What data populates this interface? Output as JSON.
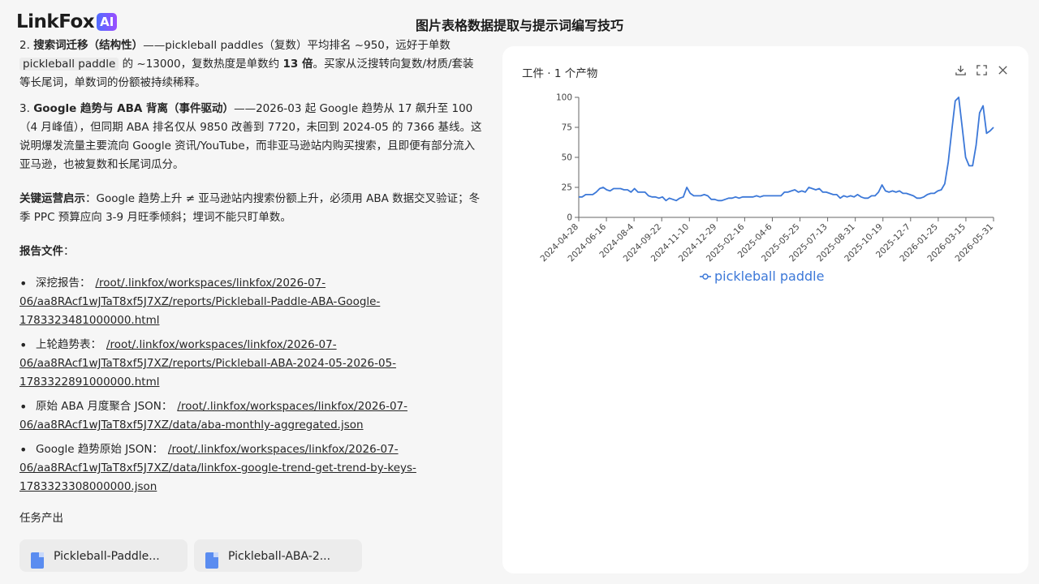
{
  "header": {
    "logo_text": "LinkFox",
    "logo_badge": "AI",
    "title": "图片表格数据提取与提示词编写技巧"
  },
  "content": {
    "para2": {
      "num": "2.",
      "heading": "搜索词迁移（结构性）",
      "text1": "——pickleball paddles（复数）平均排名 ~950，远好于单数",
      "code": "pickleball paddle",
      "text2": "的 ~13000，复数热度是单数约",
      "bold2": "13 倍",
      "text3": "。买家从泛搜转向复数/材质/套装等长尾词，单数词的份额被持续稀释。"
    },
    "para3": {
      "num": "3.",
      "heading": "Google 趋势与 ABA 背离（事件驱动）",
      "text": "——2026-03 起 Google 趋势从 17 飙升至 100（4 月峰值），但同期 ABA 排名仅从 9850 改善到 7720，未回到 2024-05 的 7366 基线。这说明爆发流量主要流向 Google 资讯/YouTube，而非亚马逊站内购买搜索，且即便有部分流入亚马逊，也被复数和长尾词瓜分。"
    },
    "insight": {
      "heading": "关键运营启示",
      "text": "：Google 趋势上升 ≠ 亚马逊站内搜索份额上升，必须用 ABA 数据交叉验证；冬季 PPC 预算应向 3-9 月旺季倾斜；埋词不能只盯单数。"
    },
    "files_label": "报告文件",
    "files_colon": "：",
    "files": [
      {
        "name": "深挖报告：",
        "path_a": "/root/.linkfox/workspaces/linkfox/2026-07-",
        "path_b": "06/aa8RAcf1wJTaT8xf5J7XZ/reports/Pickleball-Paddle-ABA-Google-",
        "path_c": "1783323481000000.html"
      },
      {
        "name": "上轮趋势表：",
        "path_a": "/root/.linkfox/workspaces/linkfox/2026-07-",
        "path_b": "06/aa8RAcf1wJTaT8xf5J7XZ/reports/Pickleball-ABA-2024-05-2026-05-",
        "path_c": "1783322891000000.html"
      },
      {
        "name": "原始 ABA 月度聚合 JSON：",
        "path_a": "/root/.linkfox/workspaces/linkfox/2026-07-",
        "path_b": "06/aa8RAcf1wJTaT8xf5J7XZ/data/aba-monthly-aggregated.json",
        "path_c": ""
      },
      {
        "name": "Google 趋势原始 JSON：",
        "path_a": "/root/.linkfox/workspaces/linkfox/2026-07-",
        "path_b": "06/aa8RAcf1wJTaT8xf5J7XZ/data/linkfox-google-trend-get-trend-by-keys-",
        "path_c": "1783323308000000.json"
      }
    ],
    "output_label": "任务产出",
    "output_cards": [
      {
        "label": "Pickleball-Paddle..."
      },
      {
        "label": "Pickleball-ABA-2..."
      }
    ]
  },
  "panel": {
    "title": "工件 · 1 个产物",
    "tools": {
      "download": "download-icon",
      "fullscreen": "fullscreen-icon",
      "close": "close-icon"
    }
  },
  "chart_data": {
    "type": "line",
    "title": "",
    "xlabel": "",
    "ylabel": "",
    "ylim": [
      0,
      100
    ],
    "yticks": [
      0,
      25,
      50,
      75,
      100
    ],
    "xticks": [
      "2024-04-28",
      "2024-06-16",
      "2024-08-4",
      "2024-09-22",
      "2024-11-10",
      "2024-12-29",
      "2025-02-16",
      "2025-04-6",
      "2025-05-25",
      "2025-07-13",
      "2025-08-31",
      "2025-10-19",
      "2025-12-7",
      "2026-01-25",
      "2026-03-15",
      "2026-05-31"
    ],
    "legend_position": "bottom-center",
    "series": [
      {
        "name": "pickleball paddle",
        "color": "#3c78d8",
        "values": [
          17,
          17,
          19,
          19,
          19,
          21,
          24,
          25,
          23,
          22,
          24,
          24,
          24,
          23,
          23,
          21,
          24,
          21,
          21,
          21,
          18,
          17,
          17,
          16,
          17,
          14,
          16,
          15,
          14,
          16,
          17,
          25,
          20,
          18,
          18,
          18,
          19,
          18,
          15,
          15,
          14,
          14,
          15,
          16,
          16,
          17,
          16,
          17,
          17,
          17,
          17,
          18,
          17,
          18,
          18,
          18,
          18,
          18,
          18,
          21,
          21,
          22,
          23,
          21,
          22,
          21,
          25,
          24,
          23,
          24,
          21,
          21,
          20,
          19,
          19,
          16,
          18,
          17,
          18,
          17,
          19,
          17,
          16,
          16,
          18,
          18,
          21,
          27,
          22,
          21,
          22,
          21,
          22,
          20,
          20,
          19,
          18,
          16,
          16,
          17,
          19,
          20,
          20,
          22,
          23,
          28,
          46,
          72,
          97,
          100,
          75,
          50,
          43,
          43,
          60,
          87,
          93,
          70,
          72,
          75
        ]
      }
    ]
  }
}
